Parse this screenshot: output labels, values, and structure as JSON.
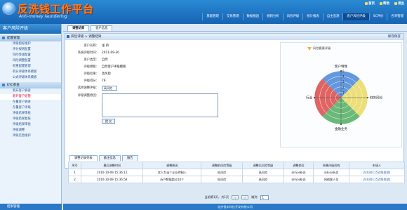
{
  "app": {
    "title": "反洗钱工作平台",
    "subtitle": "Anti-money laundering"
  },
  "utils": [
    "首页",
    "帮助",
    "退出"
  ],
  "nav": [
    "基础管理",
    "交易管理",
    "数据报送",
    "规则分析",
    "风险评级",
    "统计报表",
    "自主监测",
    "客户风险评级",
    "SC评价",
    "名单管理"
  ],
  "nav_active_index": 7,
  "sidebar": {
    "header": "客户风险评级",
    "sections": [
      {
        "title": "配置管理",
        "items": [
          "评级指标维护",
          "评分规则配置",
          "风险等级配置",
          "风险调整配置",
          "权重配置管理",
          "积分评级体系模板",
          "公式评级体系模板"
        ]
      },
      {
        "title": "KYC审查",
        "items": [
          "新开客户调查",
          "新开客户监管",
          "存量客户调查",
          "存量客户评级",
          "评级结果审核",
          "评级结果复核",
          "评级结果审批",
          "评级调整",
          "评级信息维护"
        ]
      }
    ],
    "active_item": "新开客户监管",
    "footer": "结果管理"
  },
  "main": {
    "tabs": [
      "调整结果",
      "客户信息"
    ],
    "panel_title": "风险评级 > 调整结果",
    "save_label": "保存保存",
    "fields": [
      {
        "label": "客户名称：",
        "value": "张 四"
      },
      {
        "label": "系统评级时间：",
        "value": "2011-09-30"
      },
      {
        "label": "客户类型：",
        "value": "自然"
      },
      {
        "label": "评级模板：",
        "value": "自然客户评级模板"
      },
      {
        "label": "评级结果：",
        "value": "高风险"
      },
      {
        "label": "评级得分：",
        "value": "79"
      }
    ],
    "adjust_label": "选择调整评级：",
    "adjust_value": "高风险",
    "reason_label": "评级调整原因：",
    "submit_label": "提 交",
    "bottom_tabs": [
      "调整记录列表",
      "备注信息",
      "报告"
    ]
  },
  "chart_data": {
    "type": "radar",
    "legend": "风险要素评级",
    "axes": [
      "客户特性",
      "财务风险",
      "金融业务",
      "行业"
    ],
    "ticks": [
      "1",
      "2",
      "3",
      "4",
      "5"
    ],
    "colors": [
      "#2f75d6",
      "#e7d34b",
      "#3aa24b",
      "#d6302f"
    ]
  },
  "table": {
    "headers": [
      "序号",
      "最后调整时间",
      "调整原因",
      "调整前风险等级",
      "调整后风险等级",
      "调整岗位",
      "所属评级机构",
      "申请人"
    ],
    "rows": [
      [
        "1",
        "2010-10-09 15:36:12",
        "本人为当个企业控制人",
        "低风险",
        "高风险",
        "分行分析员",
        "分行分析员",
        "240301152(陈思琪)"
      ],
      [
        "2",
        "2010-10-09 15:36:58",
        "历户数据超过10个",
        "低风险",
        "高风险",
        "分行分析员",
        "网络客人员",
        "240301152(陈思琪)"
      ]
    ]
  },
  "pager": {
    "text": "当前第1页，共1页",
    "goto": "跳到",
    "page": "1"
  },
  "footer": "北京银丰科技开发有限公司"
}
